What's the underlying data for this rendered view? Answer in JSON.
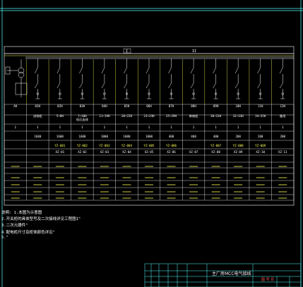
{
  "bus_labels": [
    "I",
    "II"
  ],
  "columns": [
    {
      "no": "AH",
      "name": "",
      "count": "1",
      "current": "",
      "cable": "",
      "relay": "",
      "volt": "",
      "ct": "",
      "pad": ""
    },
    {
      "no": "01H",
      "name": "进线柜",
      "count": "1",
      "current": "1600",
      "cable": "",
      "relay": "",
      "volt": "",
      "ct": "",
      "pad": ""
    },
    {
      "no": "02H",
      "name": "5~6H",
      "count": "1",
      "current": "1600",
      "cable": "YZ-001",
      "relay": "XZ-01",
      "volt": "",
      "ct": "",
      "pad": ""
    },
    {
      "no": "03H",
      "name": "7~10H\n低压出线",
      "count": "1",
      "current": "1600",
      "cable": "YZ-002",
      "relay": "XZ-02",
      "volt": "",
      "ct": "",
      "pad": ""
    },
    {
      "no": "04H",
      "name": "11~19H",
      "count": "1",
      "current": "1000",
      "cable": "YZ-003",
      "relay": "XZ-03",
      "volt": "",
      "ct": "",
      "pad": ""
    },
    {
      "no": "05H",
      "name": "20~22H",
      "count": "1",
      "current": "1000",
      "cable": "YZ-004",
      "relay": "XZ-04",
      "volt": "",
      "ct": "",
      "pad": ""
    },
    {
      "no": "06H",
      "name": "23~24H",
      "count": "1",
      "current": "1000",
      "cable": "YZ-005",
      "relay": "XZ-05",
      "volt": "",
      "ct": "",
      "pad": ""
    },
    {
      "no": "07H",
      "name": "25~29H",
      "count": "1",
      "current": "400",
      "cable": "YZ-006",
      "relay": "XZ-06",
      "volt": "",
      "ct": "",
      "pad": ""
    },
    {
      "no": "08H",
      "name": "联络柜",
      "count": "1",
      "current": "400",
      "cable": "",
      "relay": "XZ-07",
      "volt": "",
      "ct": "",
      "pad": ""
    },
    {
      "no": "09H",
      "name": "30~31H",
      "count": "1",
      "current": "400",
      "cable": "YZ-007",
      "relay": "XZ-08",
      "volt": "",
      "ct": "",
      "pad": ""
    },
    {
      "no": "10H",
      "name": "32~33H",
      "count": "1",
      "current": "200",
      "cable": "YZ-008",
      "relay": "XZ-09",
      "volt": "",
      "ct": "",
      "pad": ""
    },
    {
      "no": "11H",
      "name": "34~35H",
      "count": "1",
      "current": "200",
      "cable": "YZ-009",
      "relay": "XZ-10",
      "volt": "",
      "ct": "",
      "pad": ""
    },
    {
      "no": "12H",
      "name": "备用",
      "count": "1",
      "current": "200",
      "cable": "",
      "relay": "XZ-11",
      "volt": "",
      "ct": "",
      "pad": ""
    }
  ],
  "notes": [
    "说明: 1.本图为示意图",
    "2.开关柜的具体型号及二次接线详见工程图1\"",
    "3.二次元器件\"",
    "4.配电柜尺寸及柜体颜色详见\"",
    "5.\""
  ],
  "title_block": {
    "drawing_title": "主厂房MCC电气接线",
    "stamp": "图 号 页"
  }
}
